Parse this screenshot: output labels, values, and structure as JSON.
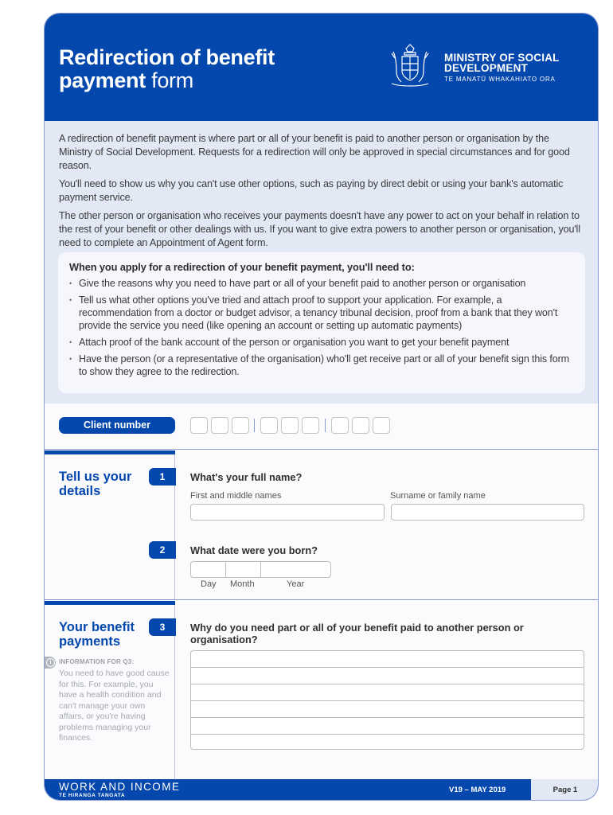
{
  "header": {
    "title_bold_1": "Redirection of benefit",
    "title_bold_2": "payment",
    "title_light": " form",
    "ministry_line1": "MINISTRY OF SOCIAL",
    "ministry_line2": "DEVELOPMENT",
    "ministry_maori": "TE MANATŪ WHAKAHIATO ORA",
    "crest_icon": "nz-coat-of-arms-icon"
  },
  "intro": {
    "paragraphs": [
      "A redirection of benefit payment is where part or all of your benefit is paid to another person or organisation by the Ministry of Social Development. Requests for a redirection will only be approved in special circumstances and for good reason.",
      "You'll need to show us why you can't use other options, such as paying by direct debit or using your bank's automatic payment service.",
      "The other person or organisation who receives your payments doesn't have any power to act on your behalf in relation to the rest of your benefit or other dealings with us. If you want to give extra powers to another person or organisation, you'll need to complete an Appointment of Agent form."
    ],
    "needs_heading": "When you apply for a redirection of your benefit payment, you'll need to:",
    "needs": [
      "Give the reasons why you need to have part or all of your benefit paid to another person or organisation",
      "Tell us what other options you've tried and attach proof to support your application. For example, a recommendation from a doctor or budget advisor, a tenancy tribunal decision, proof from a bank that they won't provide the service you need (like opening  an account or setting up automatic payments)",
      "Attach proof of the bank account of the person or organisation you want to get your benefit payment",
      "Have the person (or a representative of the organisation) who'll get receive part or all of your benefit sign this form to show they agree to the redirection."
    ]
  },
  "client_number": {
    "label": "Client number",
    "digits": [
      "",
      "",
      "",
      "",
      "",
      "",
      "",
      "",
      ""
    ]
  },
  "section1": {
    "title": "Tell us your details",
    "q1": {
      "number": "1",
      "question": "What's your full name?",
      "first_label": "First and middle names",
      "first_value": "",
      "surname_label": "Surname or family name",
      "surname_value": ""
    },
    "q2": {
      "number": "2",
      "question": "What date were you born?",
      "day_label": "Day",
      "month_label": "Month",
      "year_label": "Year",
      "day_value": "",
      "month_value": "",
      "year_value": ""
    }
  },
  "section2": {
    "title": "Your benefit payments",
    "info_icon": "info-icon",
    "info_heading": "INFORMATION FOR Q3:",
    "info_text": "You need to have good cause for this. For example, you have a health condition and can't manage your own affairs, or you're having problems managing your finances.",
    "q3": {
      "number": "3",
      "question": "Why do you need part or all of your benefit paid to another person or organisation?",
      "answer": ""
    }
  },
  "footer": {
    "brand": "WORK AND INCOME",
    "brand_sub": "TE HIRANGA TANGATA",
    "version": "V19 – MAY 2019",
    "page": "Page 1"
  },
  "colors": {
    "brand_blue": "#0447ad",
    "intro_bg": "#e3e8f5",
    "border": "#8b9bd0"
  }
}
